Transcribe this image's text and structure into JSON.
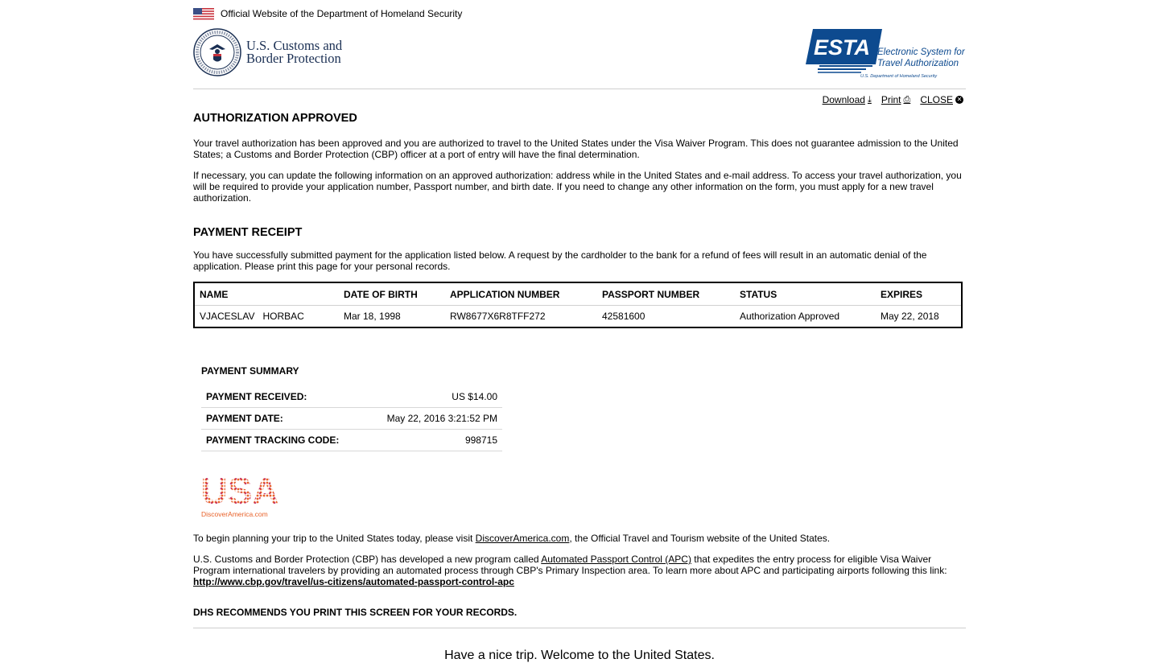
{
  "official_banner": "Official Website of the Department of Homeland Security",
  "agency": {
    "line1": "U.S. Customs and",
    "line2": "Border Protection"
  },
  "esta": {
    "wordmark": "ESTA",
    "line1": "Electronic System for",
    "line2": "Travel Authorization",
    "sub": "U.S. Department of Homeland Security"
  },
  "actions": {
    "download": "Download",
    "print": "Print",
    "close": "CLOSE"
  },
  "approved": {
    "heading": "AUTHORIZATION APPROVED",
    "p1": "Your travel authorization has been approved and you are authorized to travel to the United States under the Visa Waiver Program. This does not guarantee admission to the United States; a Customs and Border Protection (CBP) officer at a port of entry will have the final determination.",
    "p2": "If necessary, you can update the following information on an approved authorization: address while in the United States and e-mail address. To access your travel authorization, you will be required to provide your application number, Passport number, and birth date. If you need to change any other information on the form, you must apply for a new travel authorization."
  },
  "receipt": {
    "heading": "PAYMENT RECEIPT",
    "intro": "You have successfully submitted payment for the application listed below. A request by the cardholder to the bank for a refund of fees will result in an automatic denial of the application. Please print this page for your personal records.",
    "columns": [
      "NAME",
      "DATE OF BIRTH",
      "APPLICATION NUMBER",
      "PASSPORT NUMBER",
      "STATUS",
      "EXPIRES"
    ],
    "row": {
      "name": "VJACESLAV   HORBAC",
      "dob": "Mar 18, 1998",
      "application": "RW8677X6R8TFF272",
      "passport": "42581600",
      "status": "Authorization Approved",
      "expires": "May 22, 2018"
    }
  },
  "summary": {
    "title": "PAYMENT SUMMARY",
    "rows": [
      {
        "label": "PAYMENT RECEIVED:",
        "value": "US $14.00"
      },
      {
        "label": "PAYMENT DATE:",
        "value": "May 22, 2016 3:21:52 PM"
      },
      {
        "label": "PAYMENT TRACKING CODE:",
        "value": "998715"
      }
    ]
  },
  "usa_logo": {
    "word": "USA",
    "site": "DiscoverAmerica.com"
  },
  "trip": {
    "before": "To begin planning your trip to the United States today, please visit ",
    "link": "DiscoverAmerica.com",
    "after": ", the Official Travel and Tourism website of the United States."
  },
  "apc": {
    "before": "U.S. Customs and Border Protection (CBP) has developed a new program called ",
    "link": "Automated Passport Control (APC)",
    "after": " that expedites the entry process for eligible Visa Waiver Program international travelers by providing an automated process through CBP's Primary Inspection area. To learn more about APC and participating airports following this link:",
    "url": "http://www.cbp.gov/travel/us-citizens/automated-passport-control-apc"
  },
  "recommend": "DHS RECOMMENDS YOU PRINT THIS SCREEN FOR YOUR RECORDS.",
  "farewell": "Have a nice trip. Welcome to the United States.",
  "colors": {
    "cbp_navy": "#1a2f53",
    "esta_blue": "#0d4a8f",
    "usa_orange": "#e8622a"
  },
  "icons": {
    "download": "download-icon",
    "print": "printer-icon",
    "close": "close-circle-icon",
    "flag": "us-flag-icon",
    "seal": "dhs-seal-icon"
  }
}
